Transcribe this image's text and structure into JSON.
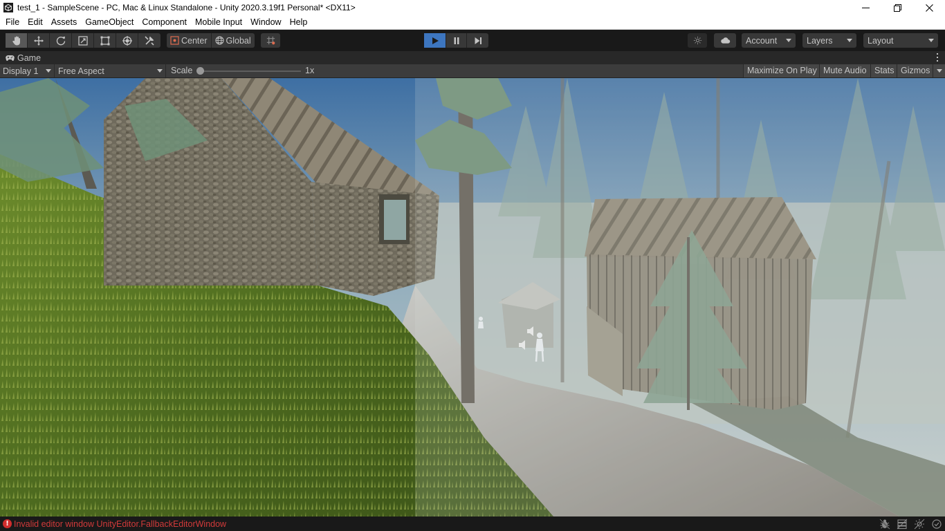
{
  "window": {
    "title": "test_1 - SampleScene - PC, Mac & Linux Standalone - Unity 2020.3.19f1 Personal* <DX11>"
  },
  "menu": [
    "File",
    "Edit",
    "Assets",
    "GameObject",
    "Component",
    "Mobile Input",
    "Window",
    "Help"
  ],
  "toolbar": {
    "tools": [
      "hand-tool-icon",
      "move-tool-icon",
      "rotate-tool-icon",
      "scale-tool-icon",
      "rect-tool-icon",
      "transform-tool-icon",
      "custom-tool-icon"
    ],
    "active_tool": "hand-tool-icon",
    "pivot_mode": "Center",
    "pivot_rotation": "Global",
    "play_active": true,
    "account": "Account",
    "layers": "Layers",
    "layout": "Layout",
    "colors": {
      "play_active": "#3d76c0",
      "error": "#d23a3a"
    }
  },
  "game_tab": {
    "label": "Game"
  },
  "game_toolbar": {
    "display": "Display 1",
    "aspect": "Free Aspect",
    "scale_label": "Scale",
    "scale_value": "1x",
    "maximize_on_play": "Maximize On Play",
    "mute_audio": "Mute Audio",
    "stats": "Stats",
    "gizmos": "Gizmos"
  },
  "status": {
    "message": "Invalid editor window UnityEditor.FallbackEditorWindow"
  }
}
